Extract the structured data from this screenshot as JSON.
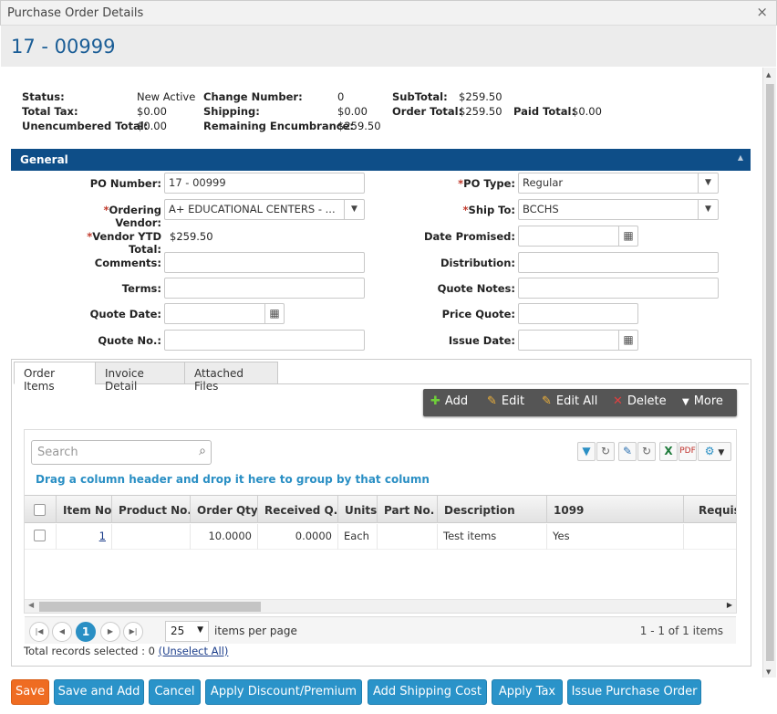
{
  "window": {
    "title": "Purchase Order Details",
    "close_glyph": "×"
  },
  "header": {
    "po_number": "17 - 00999"
  },
  "summary": {
    "status_label": "Status:",
    "status_value": "New Active",
    "total_tax_label": "Total Tax:",
    "total_tax_value": "$0.00",
    "unencumbered_label": "Unencumbered Total:",
    "unencumbered_value": "$0.00",
    "change_number_label": "Change Number:",
    "change_number_value": "0",
    "shipping_label": "Shipping:",
    "shipping_value": "$0.00",
    "remaining_label": "Remaining Encumbrance:",
    "remaining_value": "$259.50",
    "subtotal_label": "SubTotal:",
    "subtotal_value": "$259.50",
    "order_total_label": "Order Total:",
    "order_total_value": "$259.50",
    "paid_total_label": "Paid Total:",
    "paid_total_value": "$0.00"
  },
  "general": {
    "title": "General",
    "collapse_glyph": "▲",
    "po_number_label": "PO Number:",
    "po_number_value": "17 - 00999",
    "ordering_vendor_label": "Ordering Vendor:",
    "ordering_vendor_value": "A+ EDUCATIONAL CENTERS - ...",
    "vendor_ytd_label": "Vendor YTD Total:",
    "vendor_ytd_value": "$259.50",
    "comments_label": "Comments:",
    "terms_label": "Terms:",
    "quote_date_label": "Quote Date:",
    "quote_no_label": "Quote No.:",
    "po_type_label": "PO Type:",
    "po_type_value": "Regular",
    "ship_to_label": "Ship To:",
    "ship_to_value": "BCCHS",
    "date_promised_label": "Date Promised:",
    "distribution_label": "Distribution:",
    "quote_notes_label": "Quote Notes:",
    "price_quote_label": "Price Quote:",
    "issue_date_label": "Issue Date:",
    "required_mark": "*"
  },
  "tabs": [
    {
      "label": "Order Items"
    },
    {
      "label": "Invoice Detail"
    },
    {
      "label": "Attached Files"
    }
  ],
  "toolbar": {
    "add": "Add",
    "edit": "Edit",
    "edit_all": "Edit All",
    "delete": "Delete",
    "more": "More"
  },
  "grid": {
    "search_placeholder": "Search",
    "group_message": "Drag a column header and drop it here to group by that column",
    "columns": [
      "Item No.",
      "Product No.",
      "Order Qty.",
      "Received Q...",
      "Units",
      "Part No.",
      "Description",
      "1099",
      "Requis"
    ],
    "rows": [
      {
        "item_no": "1",
        "product_no": "",
        "order_qty": "10.0000",
        "received_qty": "0.0000",
        "units": "Each",
        "part_no": "",
        "description": "Test items",
        "f1099": "Yes",
        "requis": ""
      }
    ],
    "pager": {
      "current_page": "1",
      "page_size": "25",
      "items_per_page": "items per page",
      "info": "1 - 1 of 1 items"
    },
    "total_selected": "Total records selected : 0",
    "unselect_all": "(Unselect All)"
  },
  "buttons": {
    "save": "Save",
    "save_and_add": "Save and Add",
    "cancel": "Cancel",
    "apply_discount": "Apply Discount/Premium",
    "add_shipping": "Add Shipping Cost",
    "apply_tax": "Apply Tax",
    "issue_po": "Issue Purchase Order"
  }
}
